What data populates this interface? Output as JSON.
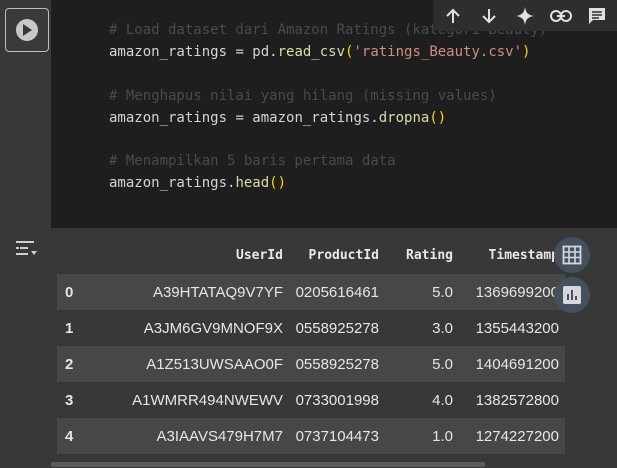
{
  "code": {
    "line1": "# Load dataset dari Amazon Ratings (kategori Beauty)",
    "line2_var": "amazon_ratings",
    "line2_eq": " = pd.",
    "line2_fn": "read_csv",
    "line2_open": "(",
    "line2_str": "'ratings_Beauty.csv'",
    "line2_close": ")",
    "line4": "# Menghapus nilai yang hilang (missing values)",
    "line5_var": "amazon_ratings",
    "line5_eq": " = amazon_ratings.",
    "line5_fn": "dropna",
    "line5_paren": "()",
    "line7": "# Menampilkan 5 baris pertama data",
    "line8_var": "amazon_ratings.",
    "line8_fn": "head",
    "line8_paren": "()"
  },
  "table": {
    "columns": [
      "",
      "UserId",
      "ProductId",
      "Rating",
      "Timestamp"
    ],
    "rows": [
      [
        "0",
        "A39HTATAQ9V7YF",
        "0205616461",
        "5.0",
        "1369699200"
      ],
      [
        "1",
        "A3JM6GV9MNOF9X",
        "0558925278",
        "3.0",
        "1355443200"
      ],
      [
        "2",
        "A1Z513UWSAAO0F",
        "0558925278",
        "5.0",
        "1404691200"
      ],
      [
        "3",
        "A1WMRR494NWEWV",
        "0733001998",
        "4.0",
        "1382572800"
      ],
      [
        "4",
        "A3IAAVS479H7M7",
        "0737104473",
        "1.0",
        "1274227200"
      ]
    ]
  },
  "icons": {
    "run": "play-icon",
    "up": "arrow-up-icon",
    "down": "arrow-down-icon",
    "gemini": "sparkle-icon",
    "link": "link-icon",
    "comment": "comment-icon",
    "output": "output-options-icon",
    "table": "table-icon",
    "chart": "bar-chart-icon"
  }
}
